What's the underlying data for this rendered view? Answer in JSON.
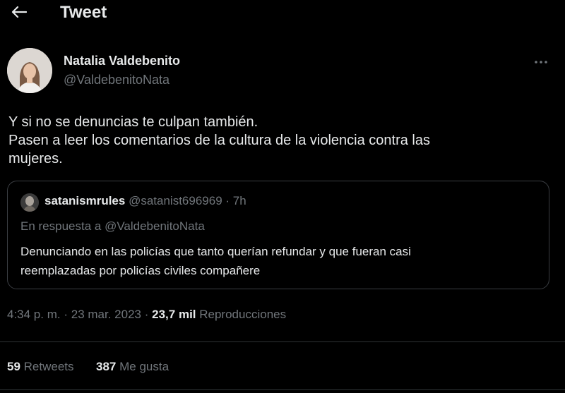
{
  "header": {
    "title": "Tweet"
  },
  "tweet": {
    "author_name": "Natalia Valdebenito",
    "author_handle": "@ValdebenitoNata",
    "text_lines": [
      "Y si no se denuncias te culpan también.",
      "Pasen a leer los comentarios de la cultura de la violencia contra las",
      "mujeres."
    ]
  },
  "quote": {
    "username": "satanismrules",
    "meta": "@satanist696969 · 7h",
    "reply_to": "En respuesta a @ValdebenitoNata",
    "text_lines": [
      "Denunciando en las policías que tanto querían refundar y que fueran casi",
      "reemplazadas por policías civiles compañere"
    ]
  },
  "meta": {
    "time": "4:34 p. m.",
    "separator": "·",
    "date": "23 mar. 2023",
    "views": "23,7 mil",
    "views_label": "Reproducciones"
  },
  "stats": {
    "retweets": "59",
    "retweets_label": "Retweets",
    "likes": "387",
    "likes_label": "Me gusta"
  },
  "icons": {
    "back": "arrow-left-icon",
    "more": "more-dots-icon"
  },
  "colors": {
    "background": "#000000",
    "text": "#e7e9ea",
    "secondary": "#71767b",
    "border": "#3a3d42"
  }
}
